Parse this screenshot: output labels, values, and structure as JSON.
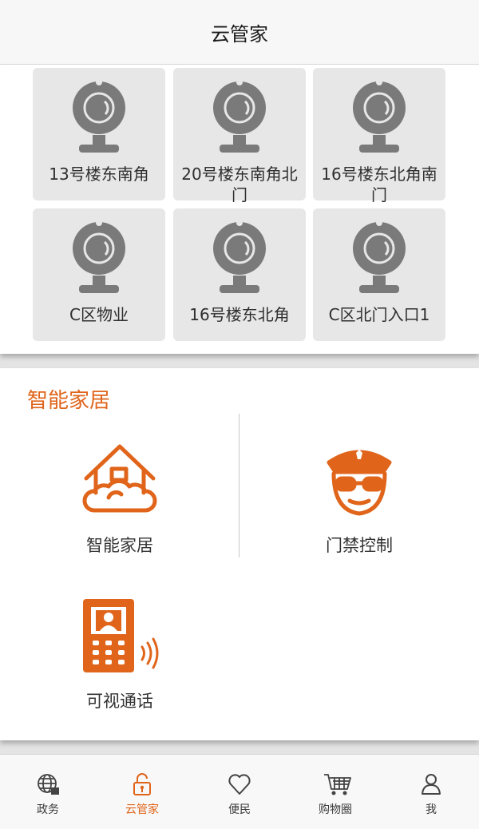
{
  "header": {
    "title": "云管家"
  },
  "cameras": [
    {
      "label": "13号楼东南角"
    },
    {
      "label": "20号楼东南角北门"
    },
    {
      "label": "16号楼东北角南门"
    },
    {
      "label": "C区物业"
    },
    {
      "label": "16号楼东北角"
    },
    {
      "label": "C区北门入口1"
    }
  ],
  "smart_home": {
    "section_title": "智能家居",
    "items": [
      {
        "label": "智能家居",
        "icon": "house-cloud-icon"
      },
      {
        "label": "门禁控制",
        "icon": "guard-icon"
      },
      {
        "label": "可视通话",
        "icon": "video-intercom-icon"
      }
    ]
  },
  "tabbar": {
    "tabs": [
      {
        "label": "政务",
        "icon": "globe-icon"
      },
      {
        "label": "云管家",
        "icon": "lock-icon",
        "active": true
      },
      {
        "label": "便民",
        "icon": "heart-icon"
      },
      {
        "label": "购物圈",
        "icon": "cart-icon"
      },
      {
        "label": "我",
        "icon": "person-icon"
      }
    ]
  },
  "colors": {
    "accent": "#e0651b",
    "camera_icon": "#7a7a7a",
    "tile_bg": "#e7e7e7"
  }
}
